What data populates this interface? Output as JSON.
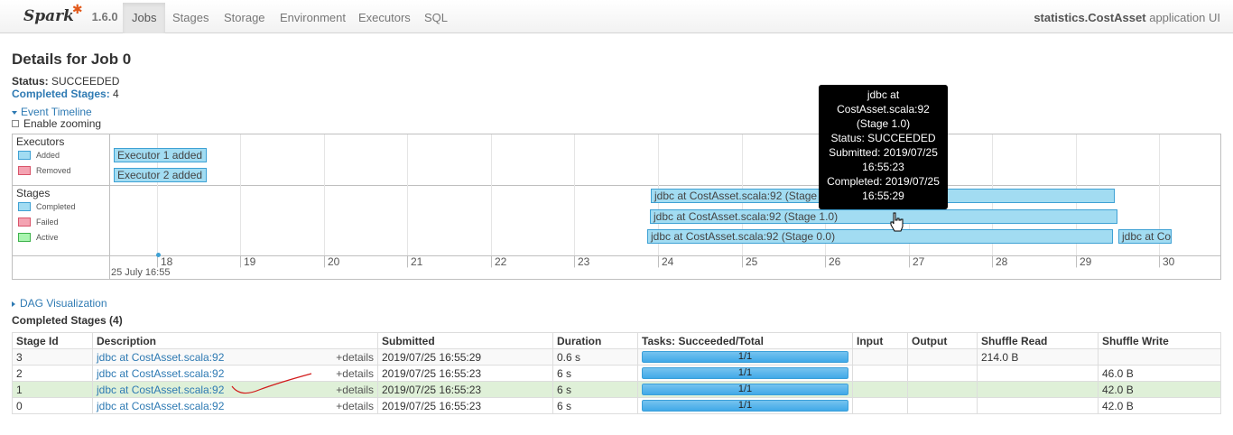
{
  "navbar": {
    "brand": "Spark",
    "version": "1.6.0",
    "tabs": [
      "Jobs",
      "Stages",
      "Storage",
      "Environment",
      "Executors",
      "SQL"
    ],
    "active_tab": "Jobs",
    "app_name": "statistics.CostAsset",
    "app_suffix": "application UI"
  },
  "page": {
    "title": "Details for Job 0",
    "status_label": "Status:",
    "status_value": "SUCCEEDED",
    "completed_label": "Completed Stages:",
    "completed_value": "4"
  },
  "timeline": {
    "toggle_label": "Event Timeline",
    "zoom_label": "Enable zooming",
    "executors_group": "Executors",
    "stages_group": "Stages",
    "legend_executors": [
      {
        "label": "Added",
        "color": "#a2dcf2"
      },
      {
        "label": "Removed",
        "color": "#f4a3b2"
      }
    ],
    "legend_stages": [
      {
        "label": "Completed",
        "color": "#a2dcf2"
      },
      {
        "label": "Failed",
        "color": "#f4a3b2"
      },
      {
        "label": "Active",
        "color": "#a9f5b0"
      }
    ],
    "executor_items": [
      "Executor 1 added",
      "Executor 2 added"
    ],
    "stage_items": [
      "jdbc at CostAsset.scala:92 (Stage",
      "jdbc at CostAsset.scala:92 (Stage 1.0)",
      "jdbc at CostAsset.scala:92 (Stage 0.0)",
      "jdbc at Co"
    ],
    "axis_ticks": [
      "18",
      "19",
      "20",
      "21",
      "22",
      "23",
      "24",
      "25",
      "26",
      "27",
      "28",
      "29",
      "30"
    ],
    "axis_date": "25 July 16:55",
    "tooltip": {
      "line1": "jdbc at",
      "line2": "CostAsset.scala:92",
      "line3": "(Stage 1.0)",
      "line4": "Status: SUCCEEDED",
      "line5": "Submitted: 2019/07/25",
      "line6": "16:55:23",
      "line7": "Completed: 2019/07/25",
      "line8": "16:55:29"
    }
  },
  "dag": {
    "label": "DAG Visualization"
  },
  "stages_table": {
    "title": "Completed Stages (4)",
    "headers": [
      "Stage Id",
      "Description",
      "Submitted",
      "Duration",
      "Tasks: Succeeded/Total",
      "Input",
      "Output",
      "Shuffle Read",
      "Shuffle Write"
    ],
    "details_label": "+details",
    "rows": [
      {
        "id": "3",
        "desc": "jdbc at CostAsset.scala:92",
        "submitted": "2019/07/25 16:55:29",
        "duration": "0.6 s",
        "tasks": "1/1",
        "tasks_fraction": 1.0,
        "input": "",
        "output": "",
        "shuffle_read": "214.0 B",
        "shuffle_write": ""
      },
      {
        "id": "2",
        "desc": "jdbc at CostAsset.scala:92",
        "submitted": "2019/07/25 16:55:23",
        "duration": "6 s",
        "tasks": "1/1",
        "tasks_fraction": 1.0,
        "input": "",
        "output": "",
        "shuffle_read": "",
        "shuffle_write": "46.0 B"
      },
      {
        "id": "1",
        "desc": "jdbc at CostAsset.scala:92",
        "submitted": "2019/07/25 16:55:23",
        "duration": "6 s",
        "tasks": "1/1",
        "tasks_fraction": 1.0,
        "input": "",
        "output": "",
        "shuffle_read": "",
        "shuffle_write": "42.0 B"
      },
      {
        "id": "0",
        "desc": "jdbc at CostAsset.scala:92",
        "submitted": "2019/07/25 16:55:23",
        "duration": "6 s",
        "tasks": "1/1",
        "tasks_fraction": 1.0,
        "input": "",
        "output": "",
        "shuffle_read": "",
        "shuffle_write": "42.0 B"
      }
    ]
  },
  "colors": {
    "link": "#2e7ab3",
    "highlight_row": "#dff0d8",
    "spark_orange": "#e25a1c"
  }
}
